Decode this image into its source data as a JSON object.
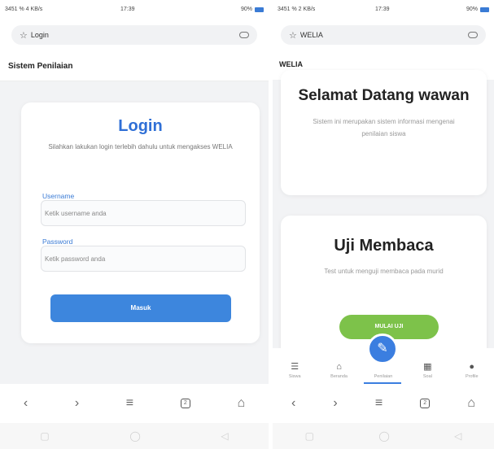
{
  "left": {
    "status": {
      "left": "3451 % 4 KB/s",
      "time": "17:39",
      "right": "90%"
    },
    "urlbar": {
      "title": "Login"
    },
    "page_title": "Sistem Penilaian",
    "login": {
      "title": "Login",
      "subtitle": "Silahkan lakukan login terlebih dahulu untuk mengakses WELIA",
      "username_label": "Username",
      "username_placeholder": "Ketik username anda",
      "password_label": "Password",
      "password_placeholder": "Ketik password anda",
      "submit_label": "Masuk"
    }
  },
  "right": {
    "status": {
      "left": "3451 % 2 KB/s",
      "time": "17:39",
      "right": "90%"
    },
    "urlbar": {
      "title": "WELIA"
    },
    "page_title": "WELIA",
    "card1": {
      "heading": "Selamat Datang wawan",
      "text": "Sistem ini merupakan sistem informasi mengenai penilaian siswa"
    },
    "card2": {
      "heading": "Uji Membaca",
      "text": "Test untuk menguji membaca pada murid",
      "button": "MULAI UJI"
    },
    "app_nav": [
      {
        "label": "Siswa",
        "icon": "stack-icon"
      },
      {
        "label": "Beranda",
        "icon": "home-icon"
      },
      {
        "label": "Penilaian",
        "icon": "pencil-icon"
      },
      {
        "label": "Soal",
        "icon": "table-icon"
      },
      {
        "label": "Profile",
        "icon": "user-icon"
      }
    ]
  },
  "browser_nav": {
    "back": "‹",
    "forward": "›",
    "menu": "≡",
    "tabs_count": "2",
    "home": "⌂"
  }
}
